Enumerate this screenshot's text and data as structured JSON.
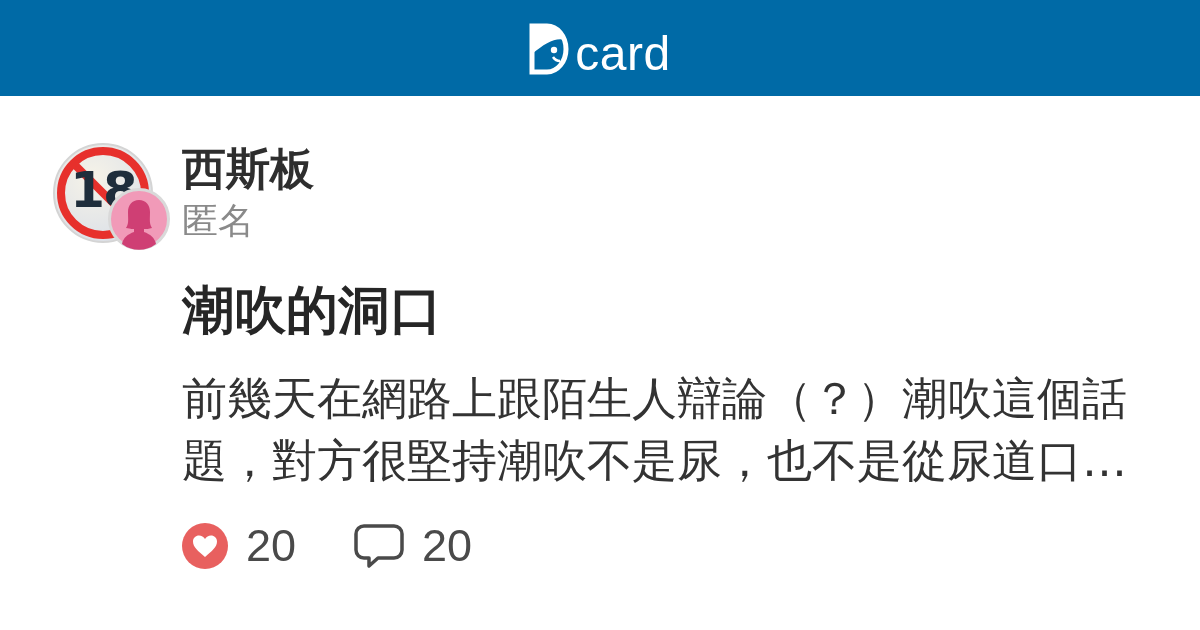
{
  "header": {
    "logo_text": "card"
  },
  "board": {
    "avatar_label": "18",
    "name": "西斯板"
  },
  "author": {
    "name": "匿名"
  },
  "post": {
    "title": "潮吹的洞口",
    "excerpt": "前幾天在網路上跟陌生人辯論（？）潮吹這個話題，對方很堅持潮吹不是尿，也不是從尿道口…"
  },
  "stats": [
    {
      "kind": "like",
      "count": "20"
    },
    {
      "kind": "comment",
      "count": "20"
    }
  ]
}
